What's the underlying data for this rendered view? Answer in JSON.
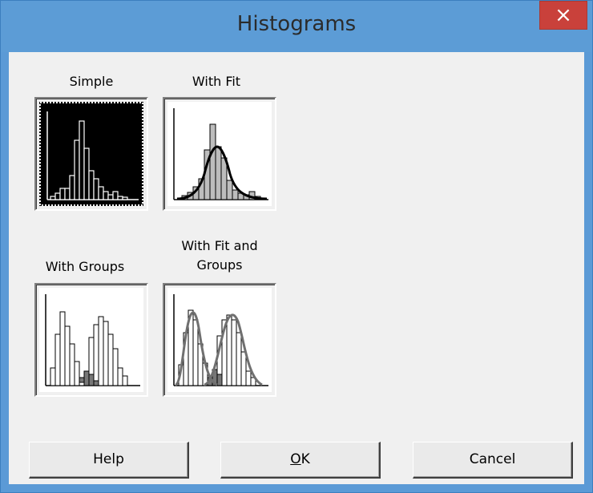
{
  "window": {
    "title": "Histograms",
    "close_glyph": "×"
  },
  "gallery": [
    {
      "id": "simple",
      "label": "Simple",
      "selected": true,
      "icon": "histogram-simple-icon"
    },
    {
      "id": "with-fit",
      "label": "With Fit",
      "selected": false,
      "icon": "histogram-fit-icon"
    },
    {
      "id": "with-groups",
      "label": "With Groups",
      "selected": false,
      "icon": "histogram-groups-icon"
    },
    {
      "id": "with-fit-and-groups",
      "label_line1": "With Fit and",
      "label_line2": "Groups",
      "selected": false,
      "icon": "histogram-fit-groups-icon"
    }
  ],
  "buttons": {
    "help": "Help",
    "ok": "OK",
    "cancel": "Cancel"
  },
  "colors": {
    "titlebar": "#5c9cd6",
    "close": "#c9413b",
    "dialog": "#f0f0f0"
  }
}
